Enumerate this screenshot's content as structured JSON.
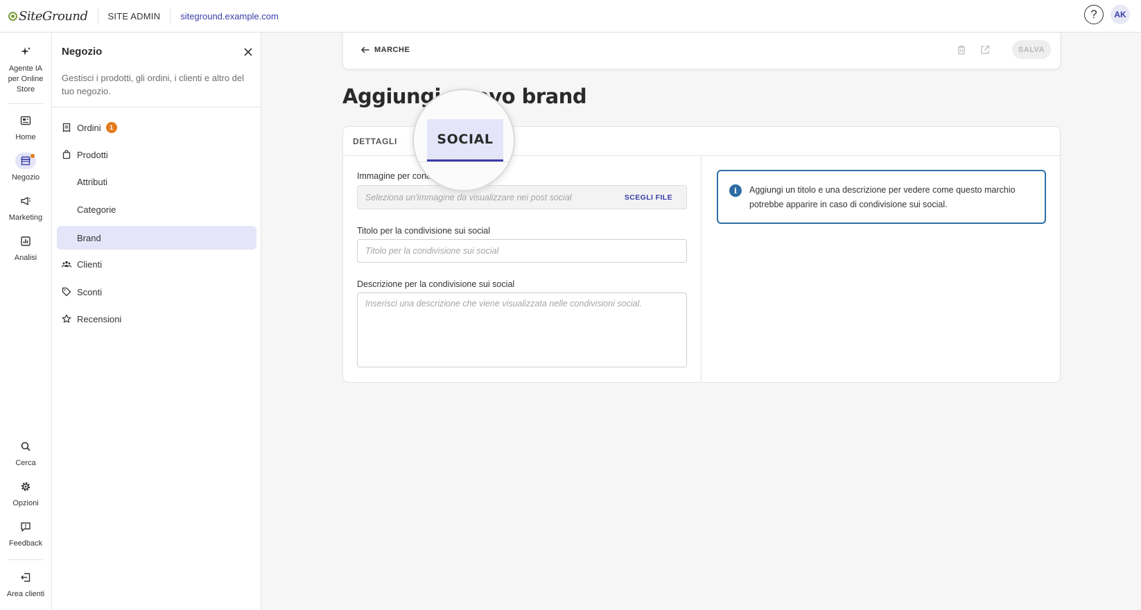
{
  "topbar": {
    "logo_text": "SiteGround",
    "site_admin": "SITE ADMIN",
    "site_url": "siteground.example.com",
    "help_label": "?",
    "avatar_initials": "AK"
  },
  "rail": {
    "ai_agent": "Agente IA per Online Store",
    "home": "Home",
    "store": "Negozio",
    "marketing": "Marketing",
    "analytics": "Analisi",
    "search": "Cerca",
    "options": "Opzioni",
    "feedback": "Feedback",
    "client_area": "Area clienti"
  },
  "panel": {
    "title": "Negozio",
    "description": "Gestisci i prodotti, gli ordini, i clienti e altro del tuo negozio.",
    "items": [
      {
        "label": "Ordini",
        "badge": "1"
      },
      {
        "label": "Prodotti"
      },
      {
        "label": "Attributi"
      },
      {
        "label": "Categorie"
      },
      {
        "label": "Brand"
      },
      {
        "label": "Clienti"
      },
      {
        "label": "Sconti"
      },
      {
        "label": "Recensioni"
      }
    ]
  },
  "header": {
    "back_label": "MARCHE",
    "save_label": "SALVA"
  },
  "page": {
    "title": "Aggiungi nuovo brand"
  },
  "tabs": {
    "details": "DETTAGLI",
    "social": "SOCIAL"
  },
  "form": {
    "image_label": "Immagine per condivisione sui social",
    "image_placeholder": "Seleziona un'immagine da visualizzare nei post social",
    "choose_file": "SCEGLI FILE",
    "title_label": "Titolo per la condivisione sui social",
    "title_placeholder": "Titolo per la condivisione sui social",
    "desc_label": "Descrizione per la condivisione sui social",
    "desc_placeholder": "Inserisci una descrizione che viene visualizzata nelle condivisioni social."
  },
  "info": {
    "icon_letter": "i",
    "text": "Aggiungi un titolo e una descrizione per vedere come questo marchio potrebbe apparire in caso di condivisione sui social."
  },
  "colors": {
    "accent": "#3a3da8",
    "active_bg": "#e4e5f8",
    "badge": "#e27c1e",
    "info_border": "#2e6da4"
  }
}
